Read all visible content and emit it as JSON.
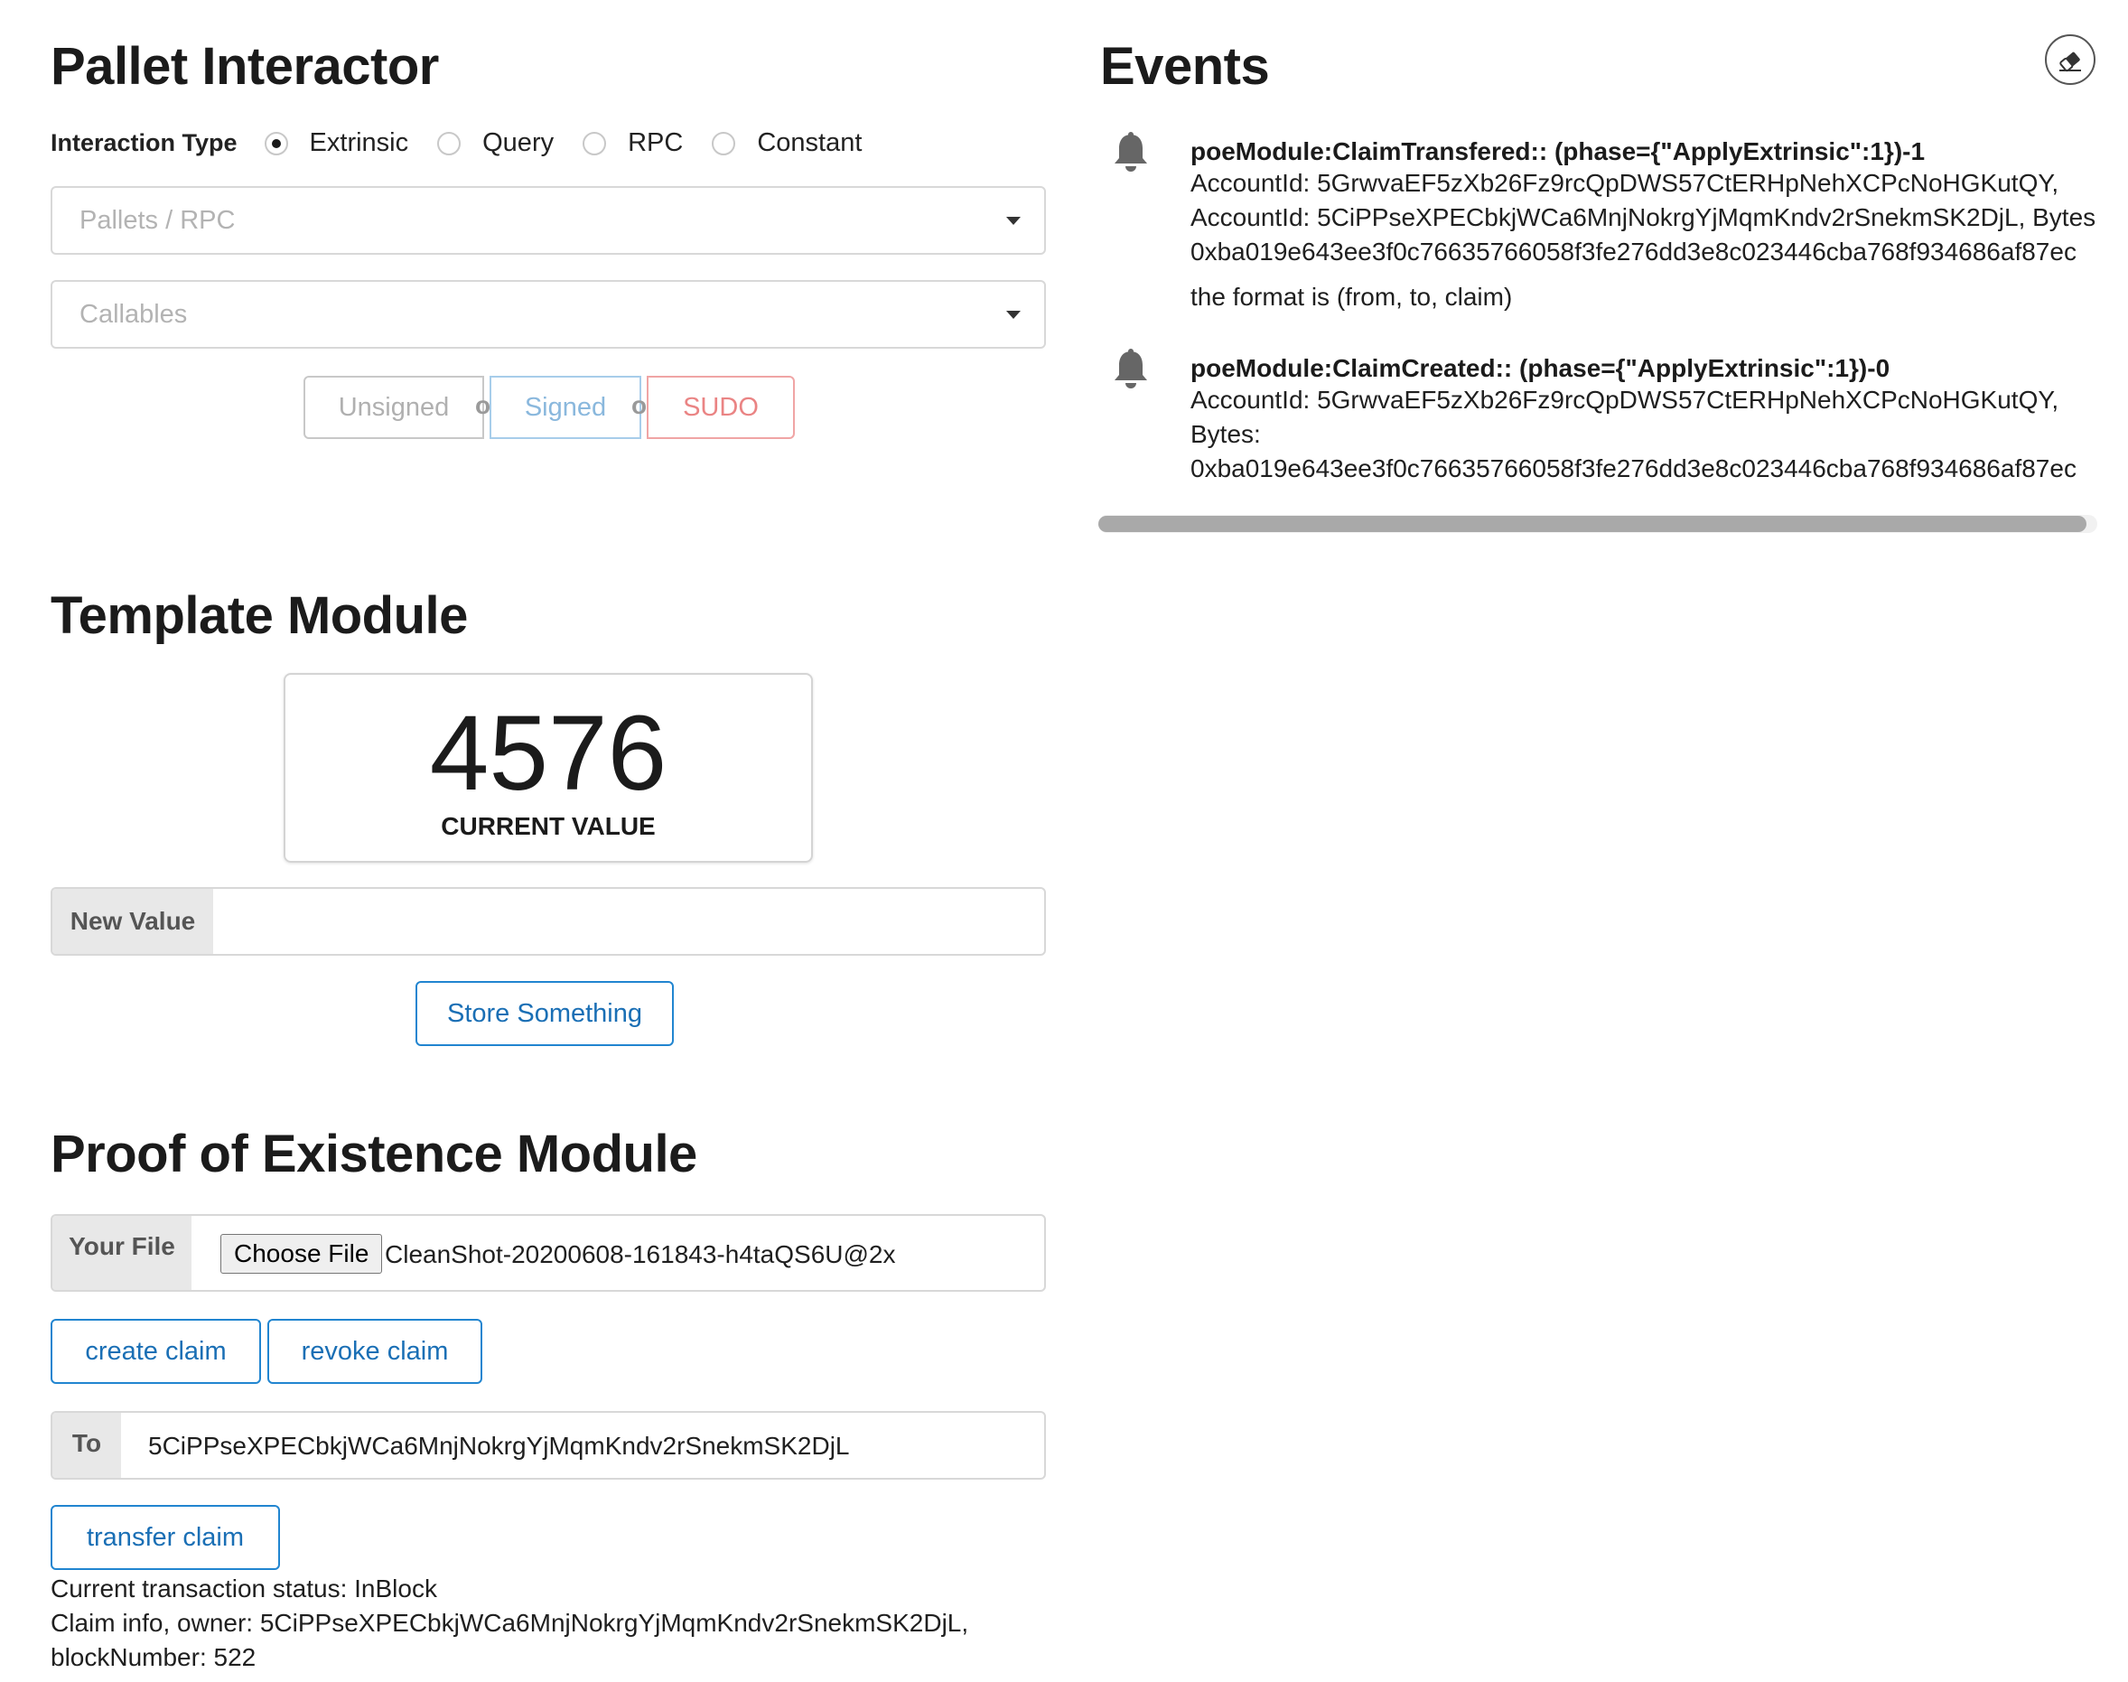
{
  "pallet_interactor": {
    "title": "Pallet Interactor",
    "interaction_type_label": "Interaction Type",
    "interaction_types": [
      "Extrinsic",
      "Query",
      "RPC",
      "Constant"
    ],
    "selected_interaction_type": "Extrinsic",
    "pallets_placeholder": "Pallets / RPC",
    "callables_placeholder": "Callables",
    "buttons": {
      "unsigned": "Unsigned",
      "or_1": "or",
      "signed": "Signed",
      "or_2": "or",
      "sudo": "SUDO"
    }
  },
  "events": {
    "title": "Events",
    "clear_icon": "eraser-icon",
    "items": [
      {
        "icon": "bell-icon",
        "title": "poeModule:ClaimTransfered:: (phase={\"ApplyExtrinsic\":1})-1",
        "lines": [
          "AccountId: 5GrwvaEF5zXb26Fz9rcQpDWS57CtERHpNehXCPcNoHGKutQY,",
          "AccountId: 5CiPPseXPECbkjWCa6MnjNokrgYjMqmKndv2rSnekmSK2DjL, Bytes:",
          "0xba019e643ee3f0c76635766058f3fe276dd3e8c023446cba768f934686af87ec"
        ],
        "note": "the format is (from, to, claim)"
      },
      {
        "icon": "bell-icon",
        "title": "poeModule:ClaimCreated:: (phase={\"ApplyExtrinsic\":1})-0",
        "lines": [
          "AccountId: 5GrwvaEF5zXb26Fz9rcQpDWS57CtERHpNehXCPcNoHGKutQY,",
          "Bytes:",
          "0xba019e643ee3f0c76635766058f3fe276dd3e8c023446cba768f934686af87ec"
        ]
      }
    ]
  },
  "template_module": {
    "title": "Template Module",
    "current_value": "4576",
    "current_value_label": "CURRENT VALUE",
    "new_value_label": "New Value",
    "new_value_input": "",
    "store_button": "Store Something"
  },
  "poe_module": {
    "title": "Proof of Existence Module",
    "your_file_label": "Your File",
    "choose_file_button": "Choose File",
    "file_name": "CleanShot-20200608-161843-h4taQS6U@2x",
    "create_claim_button": "create claim",
    "revoke_claim_button": "revoke claim",
    "to_label": "To",
    "to_value": "5CiPPseXPECbkjWCa6MnjNokrgYjMqmKndv2rSnekmSK2DjL",
    "transfer_claim_button": "transfer claim",
    "status_line_1": "Current transaction status: InBlock",
    "status_line_2": "Claim info, owner: 5CiPPseXPECbkjWCa6MnjNokrgYjMqmKndv2rSnekmSK2DjL,",
    "status_line_3": "blockNumber: 522"
  }
}
